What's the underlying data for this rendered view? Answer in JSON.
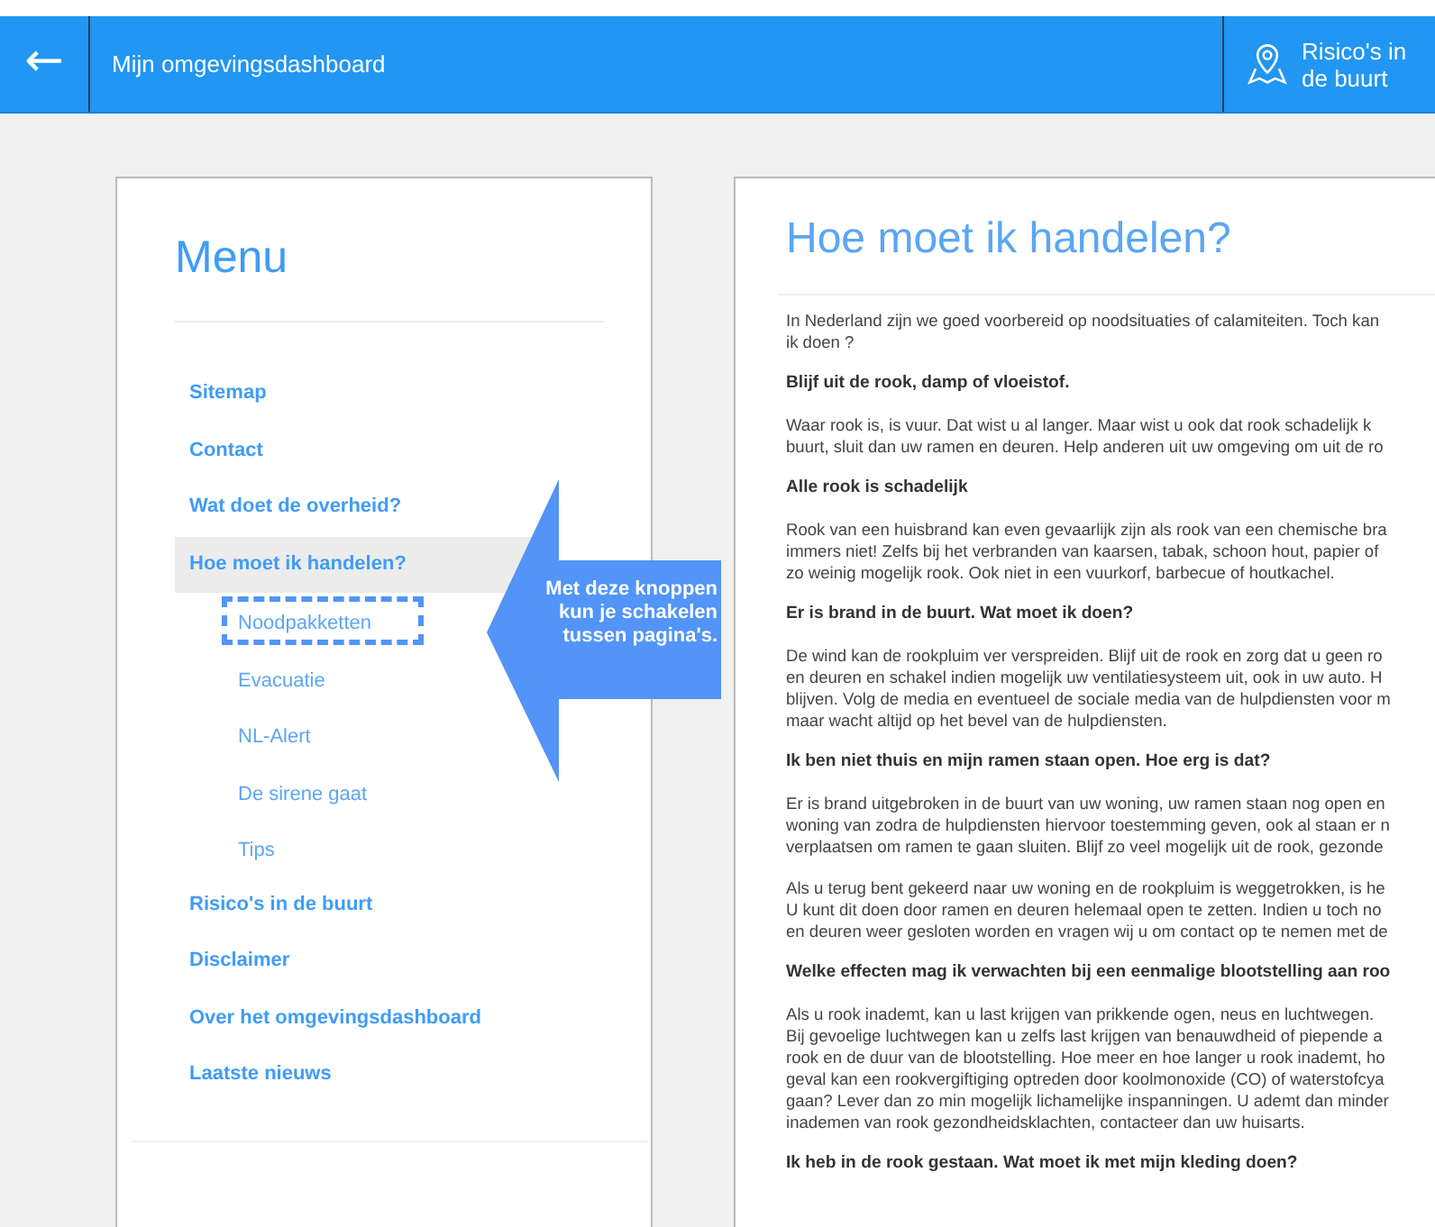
{
  "header": {
    "back_label": "←",
    "title": "Mijn omgevingsdashboard",
    "risks_button": "Risico's in de buurt"
  },
  "menu": {
    "title": "Menu",
    "items": [
      {
        "label": "Sitemap",
        "selected": false
      },
      {
        "label": "Contact",
        "selected": false
      },
      {
        "label": "Wat doet de overheid?",
        "selected": false
      },
      {
        "label": "Hoe moet ik handelen?",
        "selected": true,
        "children": [
          {
            "label": "Noodpakketten",
            "outlined": true
          },
          {
            "label": "Evacuatie",
            "outlined": false
          },
          {
            "label": "NL-Alert",
            "outlined": false
          },
          {
            "label": "De sirene gaat",
            "outlined": false
          },
          {
            "label": "Tips",
            "outlined": false
          }
        ]
      },
      {
        "label": "Risico's in de buurt",
        "selected": false
      },
      {
        "label": "Disclaimer",
        "selected": false
      },
      {
        "label": "Over het omgevingsdashboard",
        "selected": false
      },
      {
        "label": "Laatste nieuws",
        "selected": false
      }
    ]
  },
  "callout": "Met deze knoppen kun je schakelen tussen pagina's.",
  "content": {
    "title": "Hoe moet ik handelen?",
    "blocks": [
      {
        "kind": "paragraph",
        "lines": [
          "In Nederland zijn we goed voorbereid op noodsituaties of calamiteiten. Toch kan",
          "ik doen ?"
        ]
      },
      {
        "kind": "heading",
        "lines": [
          "Blijf uit de rook, damp of vloeistof."
        ]
      },
      {
        "kind": "paragraph",
        "lines": [
          "Waar rook is, is vuur. Dat wist u al langer. Maar wist u ook dat rook schadelijk k",
          "buurt, sluit dan uw ramen en deuren. Help anderen uit uw omgeving om uit de ro"
        ]
      },
      {
        "kind": "heading",
        "lines": [
          "Alle rook is schadelijk"
        ]
      },
      {
        "kind": "paragraph",
        "lines": [
          "Rook van een huisbrand kan even gevaarlijk zijn als rook van een chemische bra",
          "immers niet! Zelfs bij het verbranden van kaarsen, tabak, schoon hout, papier of",
          "zo weinig mogelijk rook. Ook niet in een vuurkorf, barbecue of houtkachel."
        ]
      },
      {
        "kind": "heading",
        "lines": [
          "Er is brand in de buurt. Wat moet ik doen?"
        ]
      },
      {
        "kind": "paragraph",
        "lines": [
          "De wind kan de rookpluim ver verspreiden. Blijf uit de rook en zorg dat u geen ro",
          "en deuren en schakel indien mogelijk uw ventilatiesysteem uit, ook in uw auto. H",
          "blijven. Volg de media en eventueel de sociale media van de hulpdiensten voor m",
          "maar wacht altijd op het bevel van de hulpdiensten."
        ]
      },
      {
        "kind": "heading",
        "lines": [
          "Ik ben niet thuis en mijn ramen staan open. Hoe erg is dat?"
        ]
      },
      {
        "kind": "paragraph",
        "lines": [
          "Er is brand uitgebroken in de buurt van uw woning, uw ramen staan nog open en",
          "woning van zodra de hulpdiensten hiervoor toestemming geven, ook al staan er n",
          "verplaatsen om ramen te gaan sluiten. Blijf zo veel mogelijk uit de rook, gezonde"
        ]
      },
      {
        "kind": "paragraph",
        "lines": [
          "Als u terug bent gekeerd naar uw woning en de rookpluim is weggetrokken, is he",
          "U kunt dit doen door ramen en deuren helemaal open te zetten. Indien u toch no",
          "en deuren weer gesloten worden en vragen wij u om contact op te nemen met de"
        ]
      },
      {
        "kind": "heading",
        "lines": [
          "Welke effecten mag ik verwachten bij een eenmalige blootstelling aan roo"
        ]
      },
      {
        "kind": "paragraph",
        "lines": [
          "Als u rook inademt, kan u last krijgen van prikkende ogen, neus en luchtwegen.",
          "Bij gevoelige luchtwegen kan u zelfs last krijgen van benauwdheid of piepende a",
          "rook en de duur van de blootstelling. Hoe meer en hoe langer u rook inademt, ho",
          "geval kan een rookvergiftiging optreden door koolmonoxide (CO) of waterstofcya",
          "gaan? Lever dan zo min mogelijk lichamelijke inspanningen. U ademt dan minder",
          "inademen van rook gezondheidsklachten, contacteer dan uw huisarts."
        ]
      },
      {
        "kind": "heading",
        "lines": [
          "Ik heb in de rook gestaan. Wat moet ik met mijn kleding doen?"
        ]
      }
    ]
  }
}
